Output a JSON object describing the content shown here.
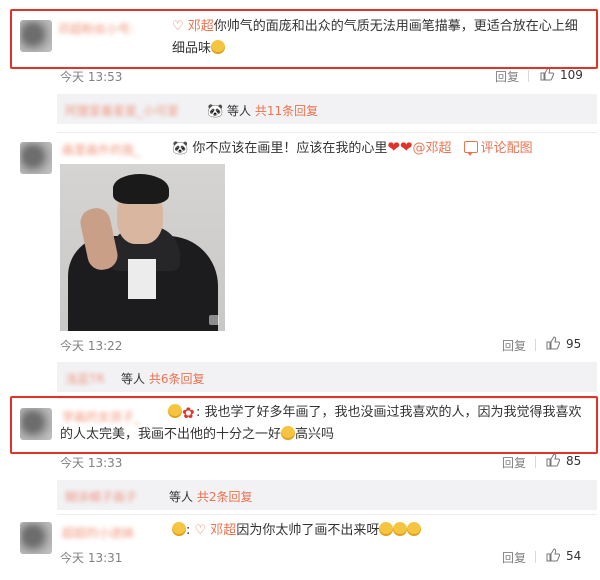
{
  "comments": [
    {
      "username": "邓超粉丝小号:",
      "mention": "♡ 邓超",
      "text": "你帅气的面庞和出众的气质无法用画笔描摹，更适合放在心上细细品味",
      "time": "今天 13:53",
      "reply_label": "回复",
      "likes": "109"
    },
    {
      "username": "画里画外的我_",
      "text": "你不应该在画里！应该在我的心里",
      "mention": "@邓超",
      "image_link": "评论配图",
      "time": "今天 13:22",
      "reply_label": "回复",
      "likes": "95"
    },
    {
      "username": "学画的女孩子_",
      "text": "我也学了好多年画了，我也没画过我喜欢的人，因为我觉得我喜欢的人太完美，我画不出他的十分之一好",
      "text_tail": "高兴吗",
      "time": "今天 13:33",
      "reply_label": "回复",
      "likes": "85"
    },
    {
      "username": "超超的小迷妹",
      "mention": "♡ 邓超",
      "text": "因为你太帅了画不出来呀",
      "time": "今天 13:31",
      "reply_label": "回复",
      "likes": "54"
    }
  ],
  "sub_replies": [
    {
      "names": "阿狸爱着星星_小可爱",
      "etc": "等人",
      "more": "共11条回复"
    },
    {
      "names": "浅蓝TR",
      "etc": "等人",
      "more": "共6条回复"
    },
    {
      "names": "糊涂橘子画子",
      "etc": "等人",
      "more": "共2条回复"
    }
  ],
  "colors": {
    "accent": "#eb7350",
    "highlight_box": "#e0342b",
    "subbar_bg": "#f2f2f5"
  },
  "icons": {
    "like": "thumbs-up-icon",
    "image": "comment-image-icon",
    "emoji_face": "smile-emoji-icon",
    "heart": "heart-emoji-icon",
    "panda": "panda-emoji-icon"
  }
}
